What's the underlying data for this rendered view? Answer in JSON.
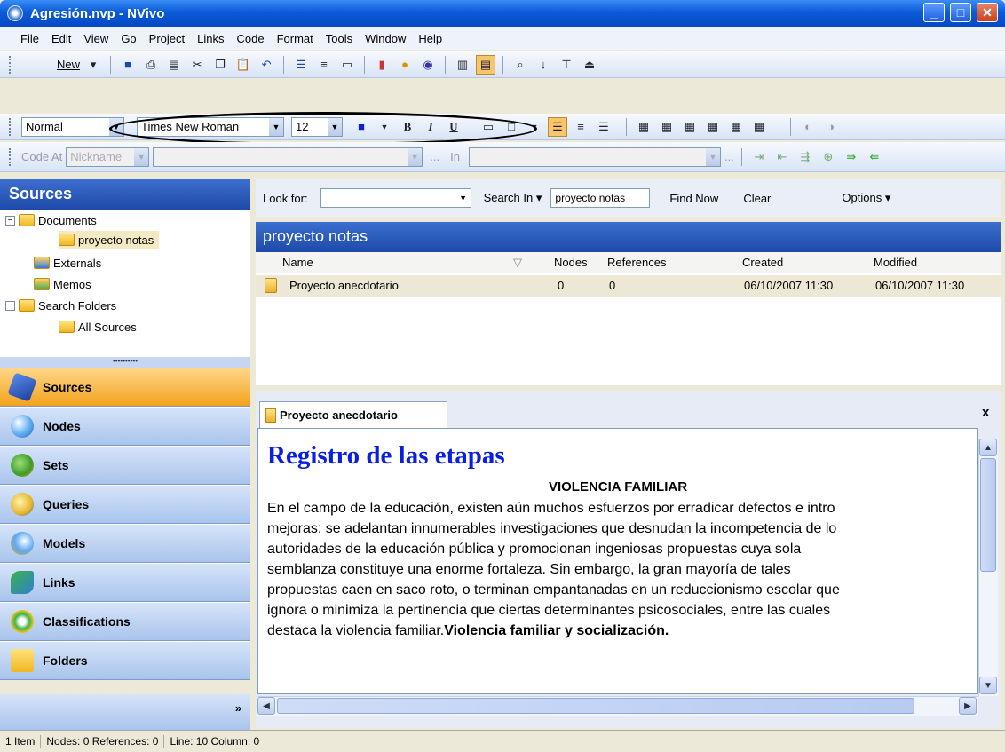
{
  "window": {
    "title": "Agresión.nvp - NVivo",
    "min": "_",
    "max": "□",
    "close": "✕"
  },
  "menu": [
    "File",
    "Edit",
    "View",
    "Go",
    "Project",
    "Links",
    "Code",
    "Format",
    "Tools",
    "Window",
    "Help"
  ],
  "toolbar1": {
    "new_label": "New"
  },
  "format_toolbar": {
    "style": "Normal",
    "font": "Times New Roman",
    "size": "12",
    "bold": "B",
    "italic": "I",
    "underline": "U"
  },
  "code_toolbar": {
    "code_at": "Code At",
    "nickname": "Nickname",
    "in": "In",
    "ellipsis1": "...",
    "ellipsis2": "..."
  },
  "sources_panel": {
    "title": "Sources",
    "tree": {
      "documents": "Documents",
      "proyecto_notas": "proyecto notas",
      "externals": "Externals",
      "memos": "Memos",
      "search_folders": "Search Folders",
      "all_sources": "All Sources"
    }
  },
  "nav": {
    "sources": "Sources",
    "nodes": "Nodes",
    "sets": "Sets",
    "queries": "Queries",
    "models": "Models",
    "links": "Links",
    "classifications": "Classifications",
    "folders": "Folders",
    "more": "»"
  },
  "find": {
    "look_for": "Look for:",
    "search_in": "Search In",
    "search_in_value": "proyecto notas",
    "find_now": "Find Now",
    "clear": "Clear",
    "options": "Options"
  },
  "list": {
    "title": "proyecto notas",
    "columns": {
      "name": "Name",
      "nodes": "Nodes",
      "references": "References",
      "created": "Created",
      "modified": "Modified"
    },
    "row": {
      "name": "Proyecto anecdotario",
      "nodes": "0",
      "references": "0",
      "created": "06/10/2007 11:30",
      "modified": "06/10/2007 11:30"
    }
  },
  "doc": {
    "tab": "Proyecto anecdotario",
    "close": "x",
    "title": "Registro de las etapas",
    "subtitle": "VIOLENCIA FAMILIAR",
    "lines": [
      "En el campo de la educación, existen aún muchos esfuerzos por erradicar defectos e intro",
      "mejoras: se adelantan innumerables investigaciones que desnudan la incompetencia de lo",
      "autoridades de la educación pública y promocionan ingeniosas propuestas cuya sola",
      "semblanza constituye una enorme fortaleza. Sin embargo, la gran mayoría de tales",
      "propuestas caen en saco roto, o terminan empantanadas en un reduccionismo escolar que",
      "ignora o minimiza la pertinencia que ciertas determinantes psicosociales, entre las cuales",
      "destaca la violencia familiar."
    ],
    "bold_tail": "Violencia familiar y socialización."
  },
  "status": {
    "items": "1 Item",
    "counts": "Nodes: 0  References: 0",
    "position": "Line: 10  Column: 0"
  }
}
